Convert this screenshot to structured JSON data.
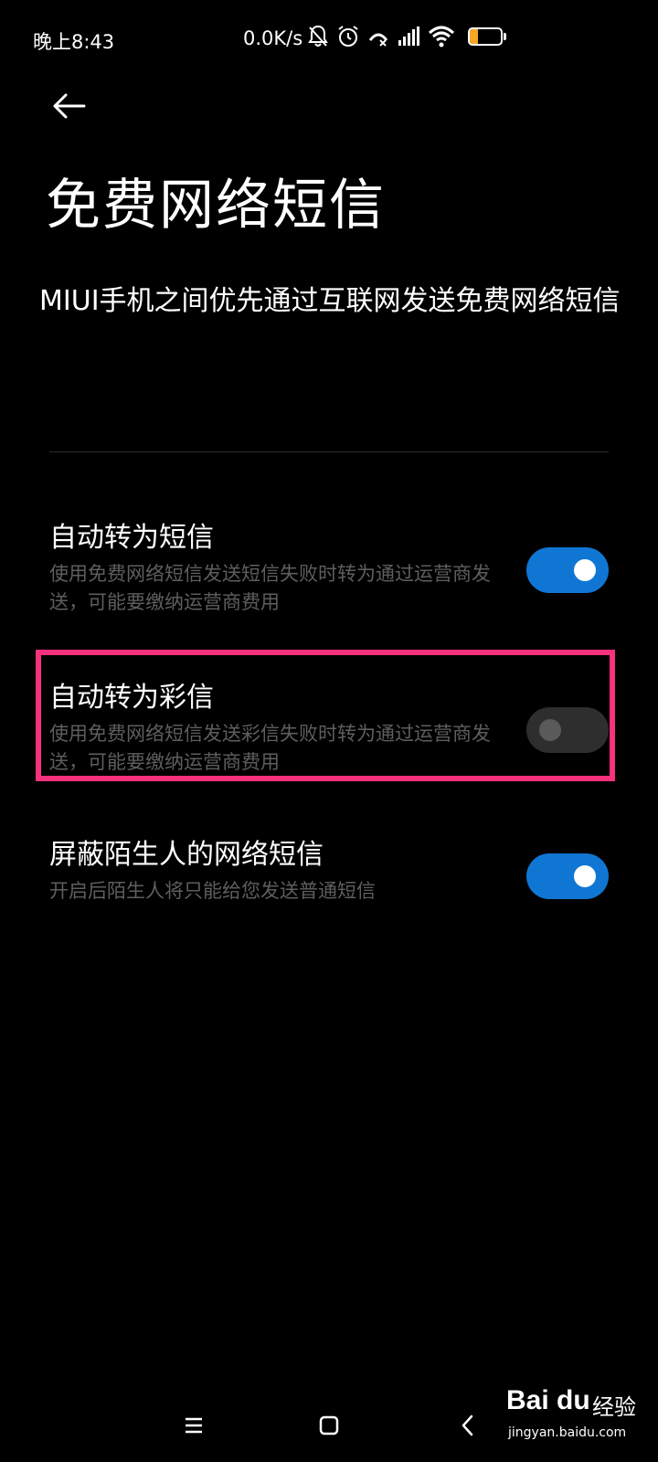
{
  "status_bar": {
    "time": "晚上8:43",
    "network_speed": "0.0K/s",
    "battery_level": "27",
    "battery_percent": 27,
    "icons": [
      "bell-off-icon",
      "alarm-icon",
      "call-forward-icon",
      "signal-icon",
      "wifi-icon",
      "battery-icon"
    ]
  },
  "header": {
    "back_icon": "back-arrow-icon",
    "title": "免费网络短信",
    "description": "MIUI手机之间优先通过互联网发送免费网络短信"
  },
  "settings": [
    {
      "title": "自动转为短信",
      "subtitle": "使用免费网络短信发送短信失败时转为通过运营商发送，可能要缴纳运营商费用",
      "enabled": true
    },
    {
      "title": "自动转为彩信",
      "subtitle": "使用免费网络短信发送彩信失败时转为通过运营商发送，可能要缴纳运营商费用",
      "enabled": false
    },
    {
      "title": "屏蔽陌生人的网络短信",
      "subtitle": "开启后陌生人将只能给您发送普通短信",
      "enabled": true
    }
  ],
  "nav_bar": {
    "icons": [
      "menu-icon",
      "home-icon",
      "back-icon"
    ]
  },
  "watermark": {
    "logo": "Bai du",
    "text": "经验",
    "url": "jingyan.baidu.com"
  },
  "colors": {
    "background": "#000000",
    "toggle_on": "#1076d4",
    "toggle_off": "#2e2e2e",
    "highlight": "#f7317c",
    "subtitle_text": "#5e5e5e"
  }
}
